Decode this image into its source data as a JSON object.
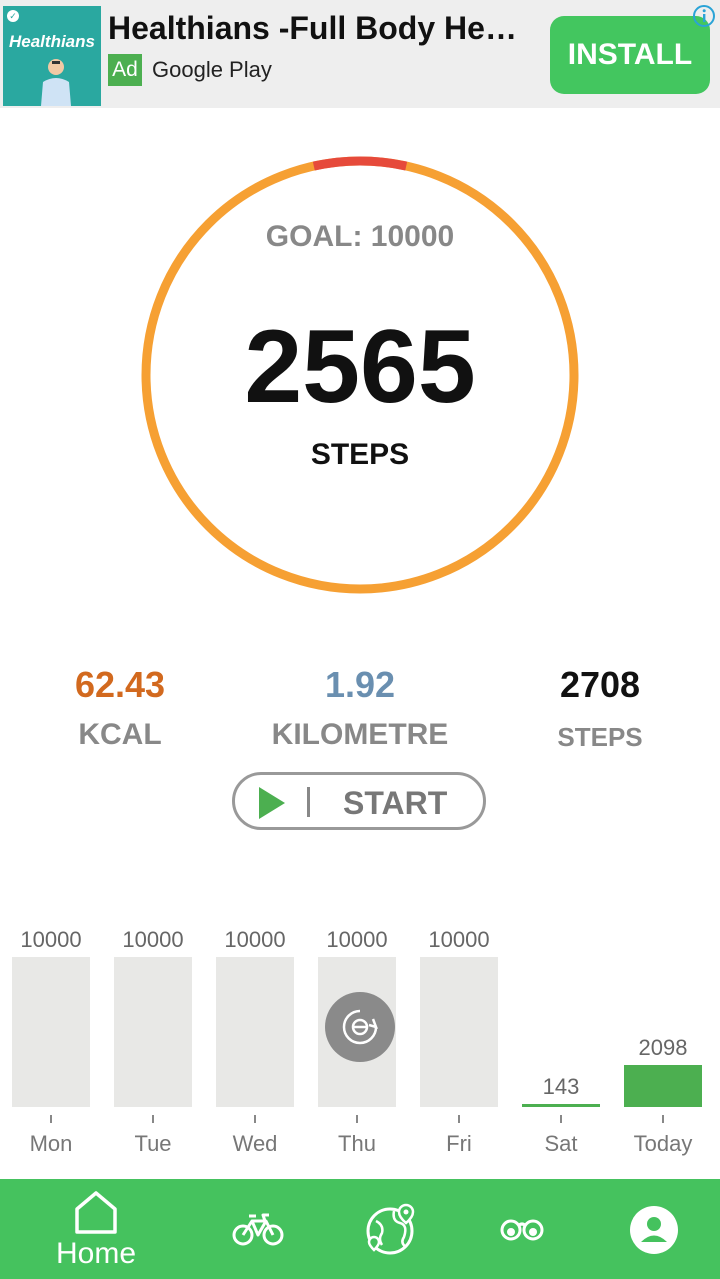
{
  "ad": {
    "thumb_brand": "Healthians",
    "title": "Healthians -Full Body He…",
    "tag": "Ad",
    "store": "Google Play",
    "install_label": "INSTALL",
    "info_icon": "info-icon"
  },
  "goal": {
    "label": "GOAL: 10000",
    "target": 10000,
    "progress_fraction": 0.2565
  },
  "current": {
    "steps": "2565",
    "steps_label": "STEPS"
  },
  "stats": [
    {
      "value": "62.43",
      "label": "KCAL",
      "color": "#d2691e"
    },
    {
      "value": "1.92",
      "label": "KILOMETRE",
      "color": "#6a8fb0"
    },
    {
      "value": "2708",
      "label": "STEPS",
      "color": "#111111"
    }
  ],
  "start_button": {
    "label": "START",
    "icon": "play-icon"
  },
  "chart_data": {
    "type": "bar",
    "categories": [
      "Mon",
      "Tue",
      "Wed",
      "Thu",
      "Fri",
      "Sat",
      "Today"
    ],
    "values": [
      10000,
      10000,
      10000,
      10000,
      10000,
      143,
      2098
    ],
    "value_labels": [
      "10000",
      "10000",
      "10000",
      "10000",
      "10000",
      "143",
      "2098"
    ],
    "goal": 10000,
    "ylim": [
      0,
      10000
    ],
    "colors": {
      "background": "#e8e8e6",
      "fill": "#4caf50"
    }
  },
  "nav": {
    "items": [
      {
        "label": "Home",
        "icon": "home-icon"
      },
      {
        "label": "",
        "icon": "bicycle-icon"
      },
      {
        "label": "",
        "icon": "map-globe-icon"
      },
      {
        "label": "",
        "icon": "binoculars-icon"
      },
      {
        "label": "",
        "icon": "profile-icon"
      }
    ],
    "color": "#45c25e"
  },
  "colors": {
    "ring_orange": "#f6a033",
    "ring_red": "#e64a3b",
    "accent_green": "#4caf50"
  }
}
